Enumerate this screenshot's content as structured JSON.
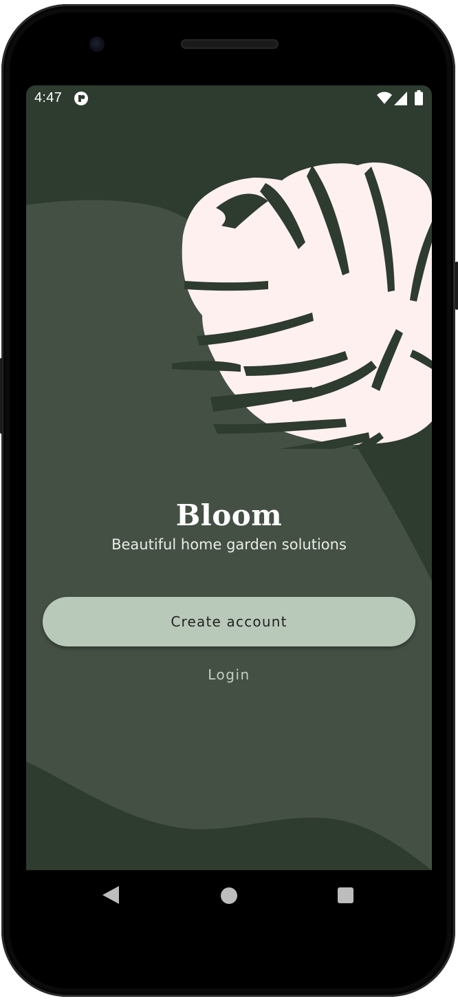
{
  "status_bar": {
    "time": "4:47"
  },
  "welcome": {
    "title": "Bloom",
    "subtitle": "Beautiful home garden solutions",
    "create_account_label": "Create account",
    "login_label": "Login"
  },
  "icons": {
    "status_app": "app-notification-icon",
    "wifi": "wifi-icon",
    "signal": "cell-signal-icon",
    "battery": "battery-icon",
    "leaf": "monstera-leaf-illustration",
    "nav_back": "back-triangle-icon",
    "nav_home": "home-circle-icon",
    "nav_recents": "recents-square-icon"
  },
  "colors": {
    "background_dark": "#2e3b2f",
    "background_wave": "#455045",
    "leaf": "#fff0f0",
    "button": "#b9c9b9",
    "button_text": "#232323",
    "login_text": "#c4cfc3"
  }
}
